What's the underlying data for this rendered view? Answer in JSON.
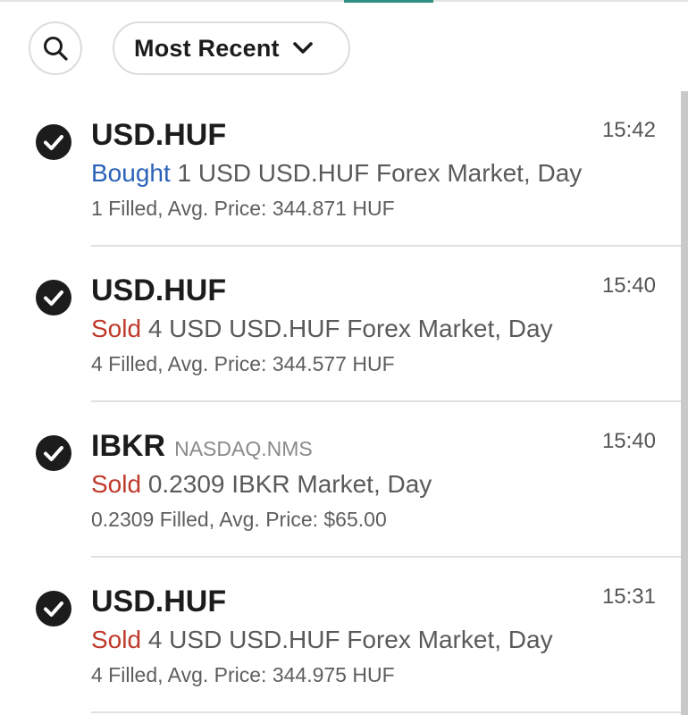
{
  "toolbar": {
    "sort_label": "Most Recent",
    "search_icon": "search-icon",
    "sort_icon": "chevron-down-icon"
  },
  "colors": {
    "bought": "#2b62b8",
    "sold": "#c0392b",
    "accent": "#2f8f83"
  },
  "orders": [
    {
      "symbol": "USD.HUF",
      "exchange": "",
      "time": "15:42",
      "side": "Bought",
      "description": " 1 USD USD.HUF Forex Market, Day",
      "fill": "1 Filled, Avg. Price: 344.871 HUF"
    },
    {
      "symbol": "USD.HUF",
      "exchange": "",
      "time": "15:40",
      "side": "Sold",
      "description": " 4 USD USD.HUF Forex Market, Day",
      "fill": "4 Filled, Avg. Price: 344.577 HUF"
    },
    {
      "symbol": "IBKR",
      "exchange": "NASDAQ.NMS",
      "time": "15:40",
      "side": "Sold",
      "description": " 0.2309 IBKR Market, Day",
      "fill": "0.2309 Filled, Avg. Price: $65.00"
    },
    {
      "symbol": "USD.HUF",
      "exchange": "",
      "time": "15:31",
      "side": "Sold",
      "description": " 4 USD USD.HUF Forex Market, Day",
      "fill": "4 Filled, Avg. Price: 344.975 HUF"
    }
  ]
}
